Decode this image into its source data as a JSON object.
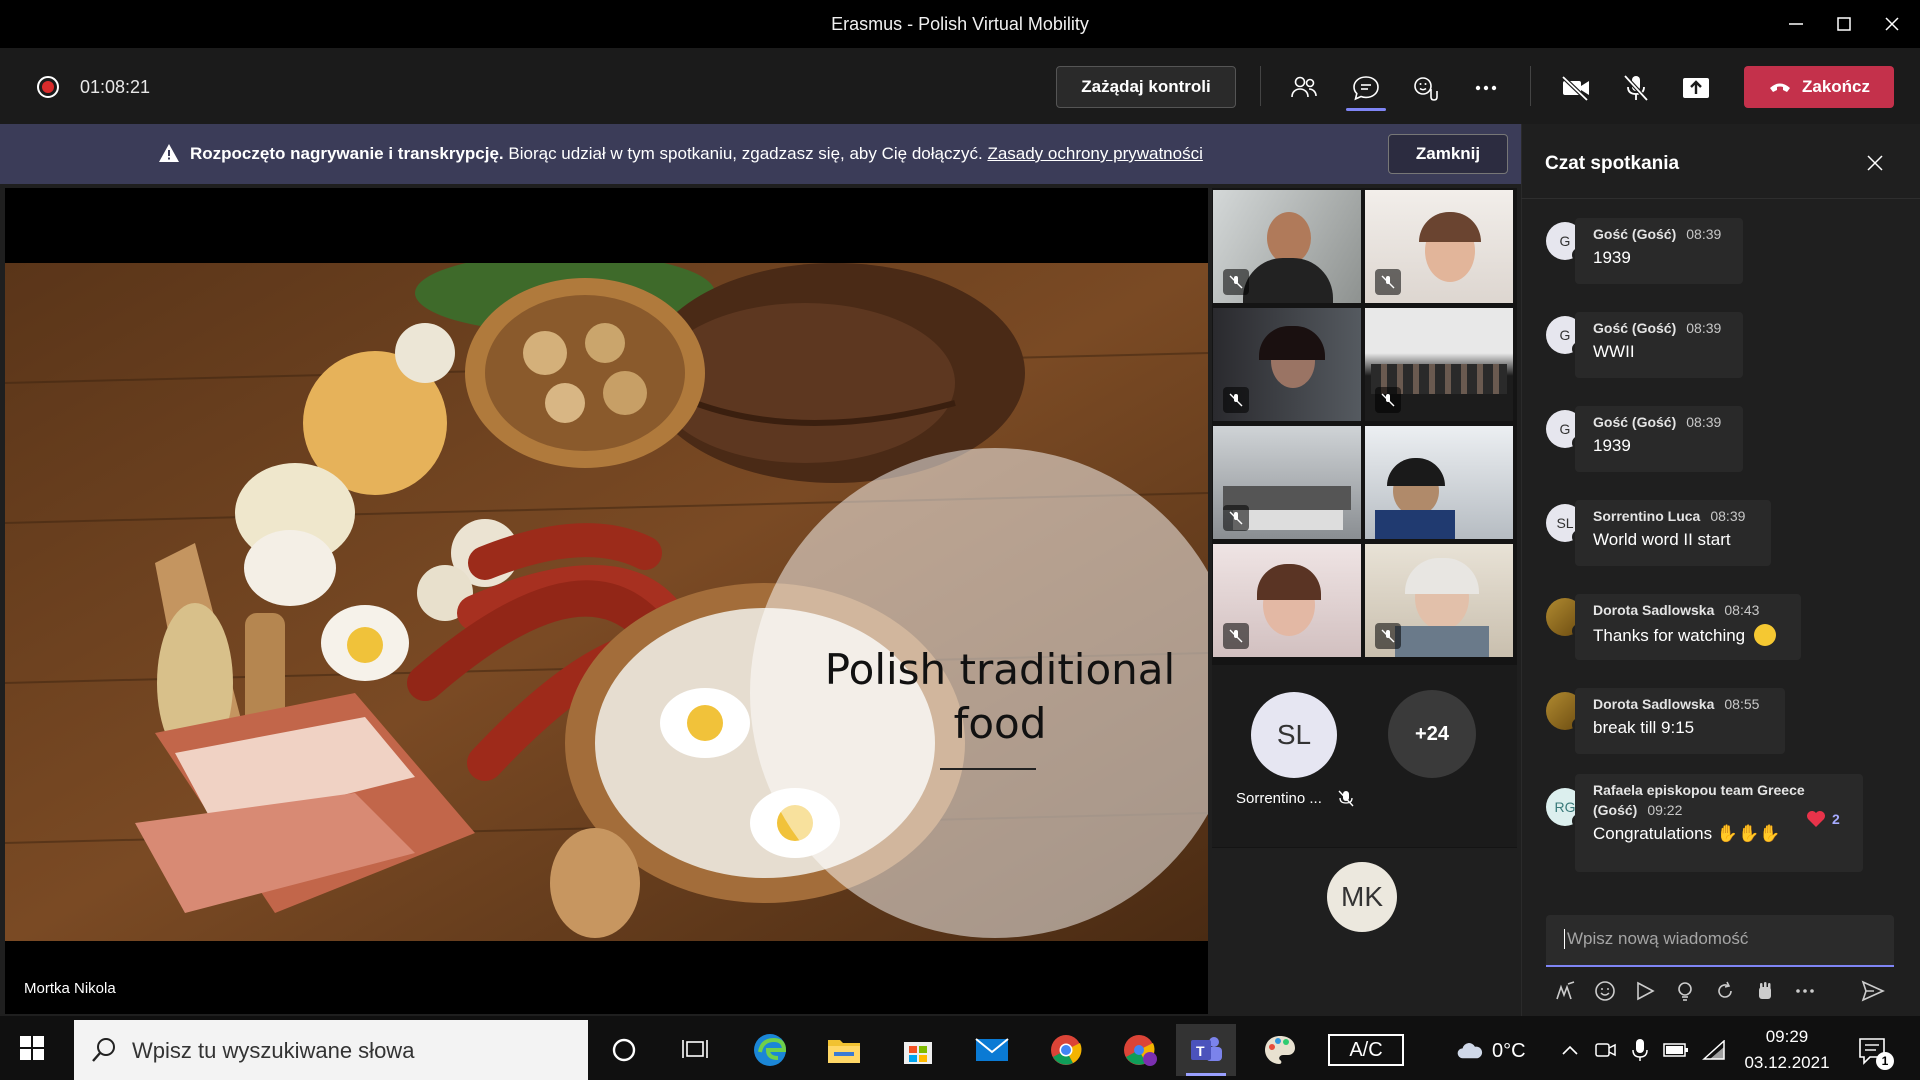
{
  "window": {
    "title": "Erasmus - Polish Virtual Mobility"
  },
  "toolbar": {
    "recording_time": "01:08:21",
    "request_control_label": "Zażądaj kontroli",
    "end_label": "Zakończ"
  },
  "banner": {
    "bold_text": "Rozpoczęto nagrywanie i transkrypcję.",
    "text": " Biorąc udział w tym spotkaniu, zgadzasz się, aby Cię dołączyć. ",
    "link": "Zasady ochrony prywatności",
    "close_label": "Zamknij"
  },
  "stage": {
    "slide_title_line1": "Polish traditional",
    "slide_title_line2": "food",
    "presenter_name": "Mortka Nikola"
  },
  "participants": {
    "sl_initials": "SL",
    "sl_name": "Sorrentino ...",
    "overflow_count": "+24",
    "mk_initials": "MK"
  },
  "chat": {
    "title": "Czat spotkania",
    "messages": [
      {
        "initials": "G",
        "name": "Gość (Gość)",
        "time": "08:39",
        "text": "1939"
      },
      {
        "initials": "G",
        "name": "Gość (Gość)",
        "time": "08:39",
        "text": "WWII"
      },
      {
        "initials": "G",
        "name": "Gość (Gość)",
        "time": "08:39",
        "text": "1939"
      },
      {
        "initials": "SL",
        "name": "Sorrentino Luca",
        "time": "08:39",
        "text": "World word II start"
      },
      {
        "initials": "",
        "name": "Dorota Sadlowska",
        "time": "08:43",
        "text": "Thanks for watching"
      },
      {
        "initials": "",
        "name": "Dorota Sadlowska",
        "time": "08:55",
        "text": "break till 9:15"
      },
      {
        "initials": "RG",
        "name_line1": "Rafaela episkopou team Greece",
        "name_line2": "(Gość)",
        "time": "09:22",
        "text": "Congratulations",
        "reaction_count": "2"
      }
    ],
    "compose_placeholder": "Wpisz nową wiadomość"
  },
  "taskbar": {
    "search_placeholder": "Wpisz tu wyszukiwane słowa",
    "keyboard_indicator": "A/C",
    "temperature": "0°C",
    "time": "09:29",
    "date": "03.12.2021",
    "notification_count": "1"
  },
  "colors": {
    "accent": "#7f85f5",
    "end_call": "#c4314b",
    "banner": "#3b3c58",
    "recording": "#d92c2c"
  }
}
